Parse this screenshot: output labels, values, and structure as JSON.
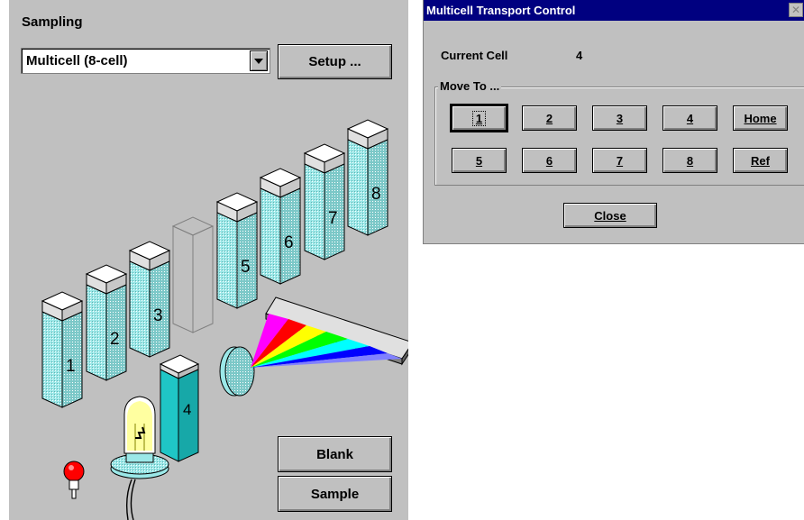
{
  "sampling": {
    "title": "Sampling",
    "accessory_value": "Multicell (8-cell)",
    "setup_label": "Setup ...",
    "blank_label": "Blank",
    "sample_label": "Sample",
    "cell_numbers": [
      "1",
      "2",
      "3",
      "4",
      "5",
      "6",
      "7",
      "8"
    ],
    "active_cell_number": "4",
    "colors": {
      "panel": "#c0c0c0",
      "cell_liquid": "#9be8e8",
      "cell_active": "#1fc6c6",
      "lamp_red": "#ff0000",
      "lamp_yellow": "#ffff00"
    }
  },
  "dialog": {
    "title": "Multicell Transport Control",
    "close_icon": "close-icon",
    "current_cell_label": "Current Cell",
    "current_cell_value": "4",
    "move_to_label": "Move To ...",
    "buttons_row1": [
      {
        "label": "1"
      },
      {
        "label": "2"
      },
      {
        "label": "3"
      },
      {
        "label": "4"
      },
      {
        "label": "Home"
      }
    ],
    "buttons_row2": [
      {
        "label": "5"
      },
      {
        "label": "6"
      },
      {
        "label": "7"
      },
      {
        "label": "8"
      },
      {
        "label": "Ref"
      }
    ],
    "close_label": "Close",
    "colors": {
      "titlebar": "#000080",
      "face": "#c0c0c0"
    }
  }
}
